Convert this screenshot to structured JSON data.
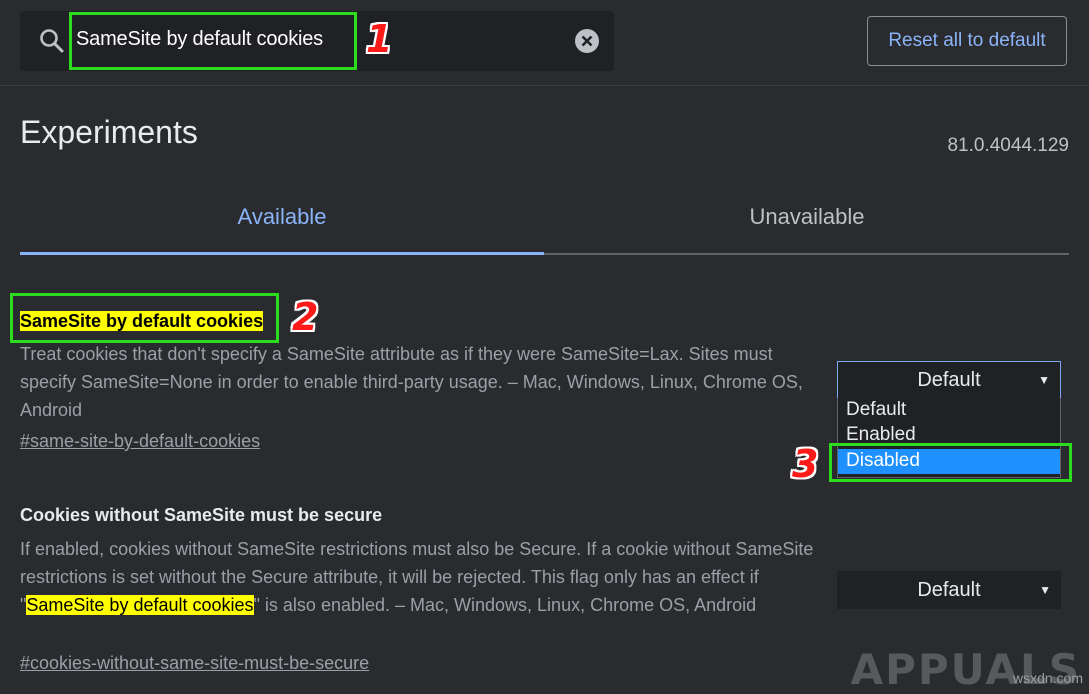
{
  "search": {
    "value": "SameSite by default cookies",
    "icon": "search-icon"
  },
  "header": {
    "reset_label": "Reset all to default"
  },
  "page": {
    "title": "Experiments",
    "version": "81.0.4044.129"
  },
  "tabs": [
    {
      "label": "Available",
      "active": true
    },
    {
      "label": "Unavailable",
      "active": false
    }
  ],
  "experiments": [
    {
      "title": "SameSite by default cookies",
      "description": "Treat cookies that don't specify a SameSite attribute as if they were SameSite=Lax. Sites must specify SameSite=None in order to enable third-party usage. – Mac, Windows, Linux, Chrome OS, Android",
      "link": "#same-site-by-default-cookies",
      "select_value": "Default",
      "options": [
        "Default",
        "Enabled",
        "Disabled"
      ],
      "highlighted_option": "Disabled"
    },
    {
      "title": "Cookies without SameSite must be secure",
      "description_before": "If enabled, cookies without SameSite restrictions must also be Secure. If a cookie without SameSite restrictions is set without the Secure attribute, it will be rejected. This flag only has an effect if \"",
      "description_highlight": "SameSite by default cookies",
      "description_after": "\" is also enabled. – Mac, Windows, Linux, Chrome OS, Android",
      "link": "#cookies-without-same-site-must-be-secure",
      "select_value": "Default"
    }
  ],
  "annotations": [
    "1",
    "2",
    "3"
  ],
  "watermark": {
    "brand": "APPUALS",
    "site": "wsxdn.com"
  },
  "colors": {
    "accent": "#8ab4f8",
    "highlight": "#ffff00",
    "annotation_box": "#2cdc1d",
    "annotation_number": "#ff1a1a",
    "selected_option": "#1e90ff"
  }
}
